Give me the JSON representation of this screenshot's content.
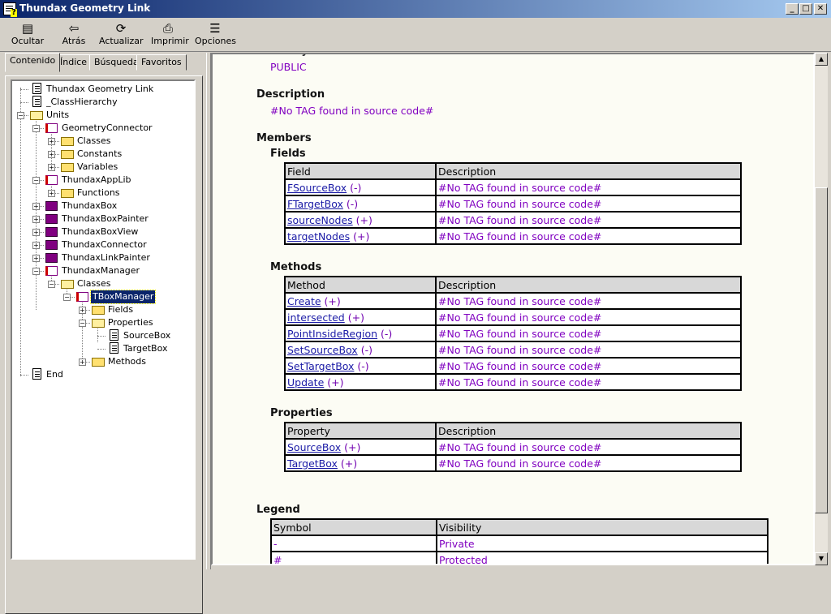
{
  "window": {
    "title": "Thundax Geometry Link"
  },
  "toolbar": [
    {
      "label": "Ocultar",
      "icon": "hide-icon"
    },
    {
      "label": "Atrás",
      "icon": "back-arrow-icon"
    },
    {
      "label": "Actualizar",
      "icon": "refresh-icon"
    },
    {
      "label": "Imprimir",
      "icon": "printer-icon"
    },
    {
      "label": "Opciones",
      "icon": "options-icon"
    }
  ],
  "tabs": [
    "Contenido",
    "Índice",
    "Búsqueda",
    "Favoritos"
  ],
  "tree": [
    {
      "label": "Thundax Geometry Link",
      "icon": "page"
    },
    {
      "label": "_ClassHierarchy",
      "icon": "page"
    },
    {
      "label": "Units",
      "icon": "folder-open"
    },
    {
      "label": "GeometryConnector",
      "icon": "book-open"
    },
    {
      "label": "Classes",
      "icon": "folder"
    },
    {
      "label": "Constants",
      "icon": "folder"
    },
    {
      "label": "Variables",
      "icon": "folder"
    },
    {
      "label": "ThundaxAppLib",
      "icon": "book-open"
    },
    {
      "label": "Functions",
      "icon": "folder"
    },
    {
      "label": "ThundaxBox",
      "icon": "book"
    },
    {
      "label": "ThundaxBoxPainter",
      "icon": "book"
    },
    {
      "label": "ThundaxBoxView",
      "icon": "book"
    },
    {
      "label": "ThundaxConnector",
      "icon": "book"
    },
    {
      "label": "ThundaxLinkPainter",
      "icon": "book"
    },
    {
      "label": "ThundaxManager",
      "icon": "book-open"
    },
    {
      "label": "Classes",
      "icon": "folder-open"
    },
    {
      "label": "TBoxManager",
      "icon": "book-open",
      "selected": true
    },
    {
      "label": "Fields",
      "icon": "folder"
    },
    {
      "label": "Properties",
      "icon": "folder-open"
    },
    {
      "label": "SourceBox",
      "icon": "page"
    },
    {
      "label": "TargetBox",
      "icon": "page"
    },
    {
      "label": "Methods",
      "icon": "folder"
    },
    {
      "label": "End",
      "icon": "page"
    }
  ],
  "doc": {
    "visibility_value": "PUBLIC",
    "description_heading": "Description",
    "description_text": "#No TAG found in source code#",
    "members_heading": "Members",
    "fields_heading": "Fields",
    "fields_table": {
      "headers": [
        "Field",
        "Description"
      ],
      "rows": [
        {
          "name": "FSourceBox",
          "vis": "(-)",
          "desc": "#No TAG found in source code#"
        },
        {
          "name": "FTargetBox",
          "vis": "(-)",
          "desc": "#No TAG found in source code#"
        },
        {
          "name": "sourceNodes",
          "vis": "(+)",
          "desc": "#No TAG found in source code#"
        },
        {
          "name": "targetNodes",
          "vis": "(+)",
          "desc": "#No TAG found in source code#"
        }
      ]
    },
    "methods_heading": "Methods",
    "methods_table": {
      "headers": [
        "Method",
        "Description"
      ],
      "rows": [
        {
          "name": "Create",
          "vis": "(+)",
          "desc": "#No TAG found in source code#"
        },
        {
          "name": "intersected",
          "vis": "(+)",
          "desc": "#No TAG found in source code#"
        },
        {
          "name": "PointInsideRegion",
          "vis": "(-)",
          "desc": "#No TAG found in source code#"
        },
        {
          "name": "SetSourceBox",
          "vis": "(-)",
          "desc": "#No TAG found in source code#"
        },
        {
          "name": "SetTargetBox",
          "vis": "(-)",
          "desc": "#No TAG found in source code#"
        },
        {
          "name": "Update",
          "vis": "(+)",
          "desc": "#No TAG found in source code#"
        }
      ]
    },
    "properties_heading": "Properties",
    "properties_table": {
      "headers": [
        "Property",
        "Description"
      ],
      "rows": [
        {
          "name": "SourceBox",
          "vis": "(+)",
          "desc": "#No TAG found in source code#"
        },
        {
          "name": "TargetBox",
          "vis": "(+)",
          "desc": "#No TAG found in source code#"
        }
      ]
    },
    "legend_heading": "Legend",
    "legend_table": {
      "headers": [
        "Symbol",
        "Visibility"
      ],
      "rows": [
        {
          "symbol": "-",
          "visibility": "Private"
        },
        {
          "symbol": "#",
          "visibility": "Protected"
        }
      ]
    }
  }
}
